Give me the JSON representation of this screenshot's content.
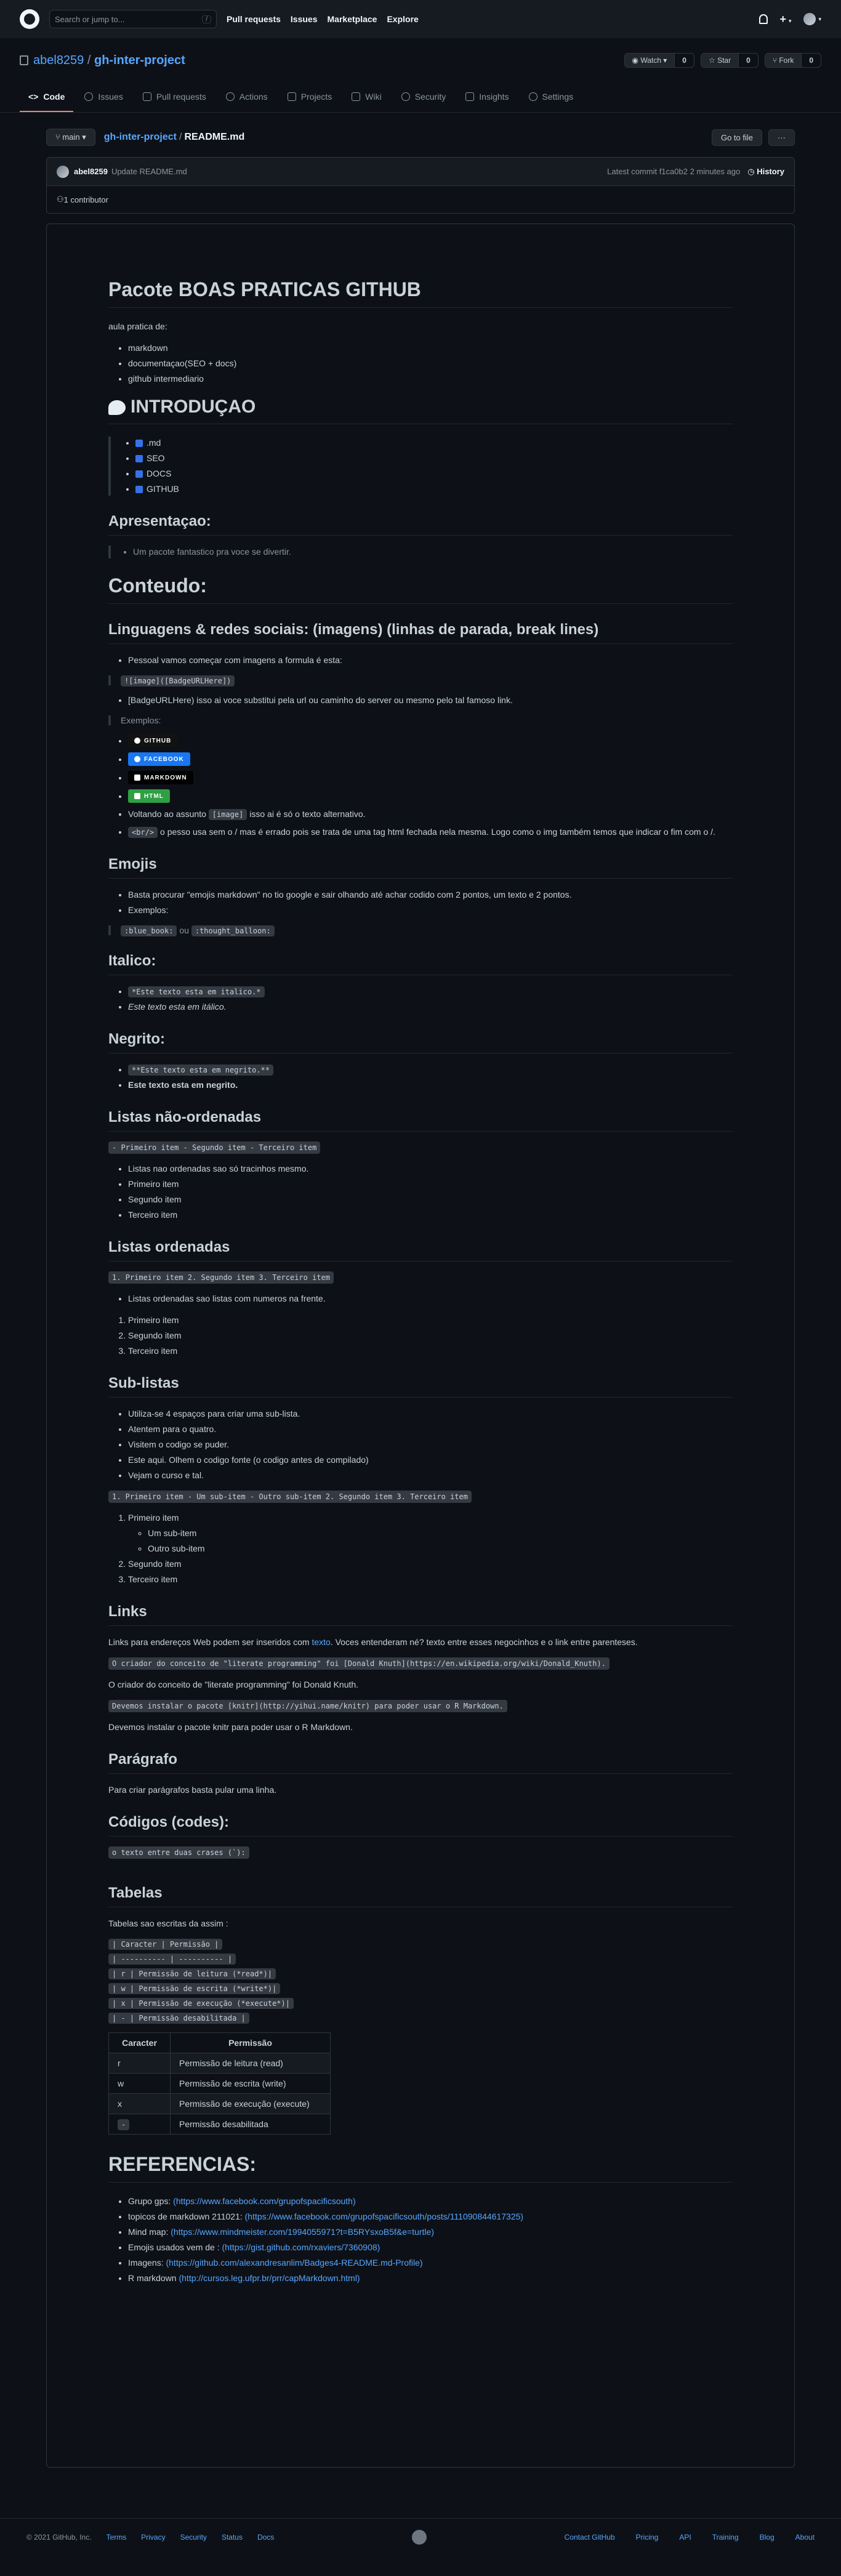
{
  "header": {
    "search_placeholder": "Search or jump to...",
    "slash_key": "/",
    "nav": [
      "Pull requests",
      "Issues",
      "Marketplace",
      "Explore"
    ]
  },
  "repo": {
    "owner": "abel8259",
    "separator": "/",
    "name": "gh-inter-project",
    "watch": {
      "label": "Watch",
      "count": "0"
    },
    "star": {
      "label": "Star",
      "count": "0"
    },
    "fork": {
      "label": "Fork",
      "count": "0"
    },
    "tabs": [
      "Code",
      "Issues",
      "Pull requests",
      "Actions",
      "Projects",
      "Wiki",
      "Security",
      "Insights",
      "Settings"
    ]
  },
  "filenav": {
    "branch": "main",
    "repo_link": "gh-inter-project",
    "file": "README.md",
    "go_to_file": "Go to file",
    "more": "···"
  },
  "commit": {
    "user": "abel8259",
    "message": "Update README.md",
    "meta": "Latest commit f1ca0b2 2 minutes ago",
    "history": "History",
    "contributors": "1 contributor"
  },
  "readme": {
    "title": "Pacote BOAS PRATICAS GITHUB",
    "intro_text": "aula pratica de:",
    "intro_list": [
      "markdown",
      "documentaçao(SEO + docs)",
      "github intermediario"
    ],
    "h_intro": "INTRODUÇAO",
    "intro_items": [
      ".md",
      "SEO",
      "DOCS",
      "GITHUB"
    ],
    "h_apresentacao": "Apresentaçao:",
    "apresentacao_quote": "Um pacote fantastico pra voce se divertir.",
    "h_conteudo": "Conteudo:",
    "h_linguagens": "Linguagens & redes sociais: (imagens) (linhas de parada, break lines)",
    "ling_item1": "Pessoal vamos começar com imagens a formula é esta:",
    "ling_code": "![image]([BadgeURLHere])",
    "ling_item2": "[BadgeURLHere) isso ai voce substitui pela url ou caminho do server ou mesmo pelo tal famoso link.",
    "exemplos": "Exemplos:",
    "badges": [
      "GITHUB",
      "FACEBOOK",
      "MARKDOWN",
      "HTML"
    ],
    "ling_item3_pre": "Voltando ao assunto",
    "ling_item3_code": "[image]",
    "ling_item3_post": "isso ai é só o texto alternativo.",
    "ling_item4_code": "<br/>",
    "ling_item4_post": "o pesso usa sem o / mas é errado pois se trata de uma tag html fechada nela mesma. Logo como o img também temos que indicar o fim com o /.",
    "h_emojis": "Emojis",
    "emoji_item1": "Basta procurar \"emojis markdown\" no tio google e sair olhando até achar codido com 2 pontos, um texto e 2 pontos.",
    "emoji_item2": "Exemplos:",
    "emoji_code1": ":blue_book:",
    "emoji_ou": "ou",
    "emoji_code2": ":thought_balloon:",
    "h_italico": "Italico:",
    "italico_code": "*Este texto esta em italico.*",
    "italico_text": "Este texto esta em itálico.",
    "h_negrito": "Negrito:",
    "negrito_code": "**Este texto esta em negrito.**",
    "negrito_text": "Este texto esta em negrito.",
    "h_nao_ordenadas": "Listas não-ordenadas",
    "nao_ord_code": "- Primeiro item - Segundo item - Terceiro item",
    "nao_ord_items": [
      "Listas nao ordenadas sao só tracinhos mesmo.",
      "Primeiro item",
      "Segundo item",
      "Terceiro item"
    ],
    "h_ordenadas": "Listas ordenadas",
    "ord_code": "1. Primeiro item 2. Segundo item 3. Terceiro item",
    "ord_note": "Listas ordenadas sao listas com numeros na frente.",
    "ord_items": [
      "Primeiro item",
      "Segundo item",
      "Terceiro item"
    ],
    "h_sublistas": "Sub-listas",
    "sub_notes": [
      "Utiliza-se 4 espaços para criar uma sub-lista.",
      "Atentem para o quatro.",
      "Visitem o codigo se puder.",
      "Este aqui. Olhem o codigo fonte (o codigo antes de compilado)",
      "Vejam o curso e tal."
    ],
    "sub_code": "1. Primeiro item - Um sub-item - Outro sub-item 2. Segundo item 3. Terceiro item",
    "sub_first": "Primeiro item",
    "sub_children": [
      "Um sub-item",
      "Outro sub-item"
    ],
    "sub_rest": [
      "Segundo item",
      "Terceiro item"
    ],
    "h_links": "Links",
    "links_p_pre": "Links para endereços Web podem ser inseridos com",
    "links_p_link": "texto",
    "links_p_post": ". Voces entenderam né? texto entre esses negocinhos e o link entre parenteses.",
    "links_code1": "O criador do conceito de \"literate programming\" foi [Donald Knuth](https://en.wikipedia.org/wiki/Donald_Knuth).",
    "links_p2": "O criador do conceito de \"literate programming\" foi Donald Knuth.",
    "links_code2": "Devemos instalar o pacote [knitr](http://yihui.name/knitr) para poder usar o R Markdown.",
    "links_p3": "Devemos instalar o pacote knitr para poder usar o R Markdown.",
    "h_paragrafo": "Parágrafo",
    "paragrafo_p": "Para criar parágrafos basta pular uma linha.",
    "h_codigos": "Códigos (codes):",
    "codigos_code": "o texto entre duas crases (`):",
    "h_tabelas": "Tabelas",
    "tabelas_p": "Tabelas sao escritas da assim :",
    "tabelas_code": [
      "| Caracter | Permissão |",
      "| ---------- | ---------- |",
      "| r | Permissão de leitura (*read*)|",
      "| w | Permissão de escrita (*write*)|",
      "| x | Permissão de execução (*execute*)|",
      "| - | Permissão desabilitada |"
    ],
    "table": {
      "headers": [
        "Caracter",
        "Permissão"
      ],
      "rows": [
        [
          "r",
          "Permissão de leitura (read)"
        ],
        [
          "w",
          "Permissão de escrita (write)"
        ],
        [
          "x",
          "Permissão de execução (execute)"
        ],
        [
          "-",
          "Permissão desabilitada"
        ]
      ]
    },
    "h_referencias": "REFERENCIAS:",
    "refs": [
      {
        "label": "Grupo gps:",
        "link": "(https://www.facebook.com/grupofspacificsouth)"
      },
      {
        "label": "topicos de markdown 211021:",
        "link": "(https://www.facebook.com/grupofspacificsouth/posts/111090844617325)"
      },
      {
        "label": "Mind map:",
        "link": "(https://www.mindmeister.com/1994055971?t=B5RYsxoB5f&e=turtle)"
      },
      {
        "label": "Emojis usados vem de :",
        "link": "(https://gist.github.com/rxaviers/7360908)"
      },
      {
        "label": "Imagens:",
        "link": "(https://github.com/alexandresanlim/Badges4-README.md-Profile)"
      },
      {
        "label": "R markdown",
        "link": "(http://cursos.leg.ufpr.br/prr/capMarkdown.html)"
      }
    ]
  },
  "footer": {
    "copyright": "© 2021 GitHub, Inc.",
    "left_links": [
      "Terms",
      "Privacy",
      "Security",
      "Status",
      "Docs"
    ],
    "right_links": [
      "Contact GitHub",
      "Pricing",
      "API",
      "Training",
      "Blog",
      "About"
    ]
  }
}
